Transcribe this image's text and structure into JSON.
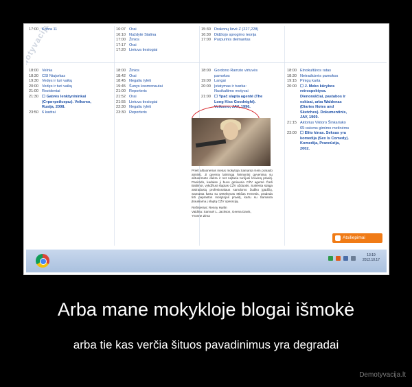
{
  "watermark": "Demotyvacija.lt",
  "schedule": {
    "col1_top": [
      {
        "time": "17:00",
        "name": "Kobra 11"
      }
    ],
    "col2_top": [
      {
        "time": "16:07",
        "name": "Orai"
      },
      {
        "time": "16:10",
        "name": "Nuždytė Stalina"
      },
      {
        "time": "17:00",
        "name": "Žinios"
      },
      {
        "time": "17:17",
        "name": "Orai"
      },
      {
        "time": "17:20",
        "name": "Lietuva tiesiogiai"
      }
    ],
    "col3_top": [
      {
        "time": "15:30",
        "name": "Drakonų lizvė Z (227,228)"
      },
      {
        "time": "16:30",
        "name": "Didžiojo sprogimo teorija"
      },
      {
        "time": "17:00",
        "name": "Purpurinis deimantas"
      }
    ],
    "col1": [
      {
        "time": "18:00",
        "name": "Velnia"
      },
      {
        "time": "18:30",
        "name": "CSI Niujorkas"
      },
      {
        "time": "19:30",
        "name": "Vedęs ir turi vaikų"
      },
      {
        "time": "20:00",
        "name": "Vedęs ir turi vaikų"
      },
      {
        "time": "21:00",
        "name": "Rezidentai"
      },
      {
        "time": "21:30",
        "name": "☐ Gatvės lenktynininkai"
      },
      {
        "time": "",
        "name": "(Стритрейсеры). Veiksmo,"
      },
      {
        "time": "",
        "name": "Rusija, 2008."
      },
      {
        "time": "23:50",
        "name": "6 kadrai"
      }
    ],
    "col2": [
      {
        "time": "18:00",
        "name": "Žinios"
      },
      {
        "time": "18:42",
        "name": "Orai"
      },
      {
        "time": "18:45",
        "name": "Negaliu tylėti"
      },
      {
        "time": "19:45",
        "name": "Šunys kosmonautai"
      },
      {
        "time": "21:00",
        "name": "Reporteris"
      },
      {
        "time": "21:52",
        "name": "Orai"
      },
      {
        "time": "21:55",
        "name": "Lietuva tiesiogiai"
      },
      {
        "time": "22:30",
        "name": "Negaliu tylėti"
      },
      {
        "time": "23:30",
        "name": "Reporteris"
      }
    ],
    "col3": [
      {
        "time": "18:00",
        "name": "Gordono Ramzio virtuvės"
      },
      {
        "time": "",
        "name": "pamokos"
      },
      {
        "time": "19:00",
        "name": "Langai"
      },
      {
        "time": "20:00",
        "name": "Įstatymas ir tvarka:"
      },
      {
        "time": "",
        "name": "Nusikaltimo motyvai"
      },
      {
        "time": "21:00",
        "name": "☐ Ypač slapta agentė (The"
      },
      {
        "time": "",
        "name": "Long Kiss Goodnight)."
      },
      {
        "time": "",
        "name": "Veiksmo, JAV, 1996."
      }
    ],
    "col4": [
      {
        "time": "18:00",
        "name": "Etnokultūros ratas"
      },
      {
        "time": "18:30",
        "name": "Netradicinės pamokos"
      },
      {
        "time": "19:15",
        "name": "Pinigų karta"
      },
      {
        "time": "20:00",
        "name": "☐ J. Meko kūrybos"
      },
      {
        "time": "",
        "name": "retrospektyva."
      },
      {
        "time": "",
        "name": "Dienoraščiai, pastabos ir"
      },
      {
        "time": "",
        "name": "eskizai, arba Waldenas"
      },
      {
        "time": "",
        "name": "(Diaries Notes and"
      },
      {
        "time": "",
        "name": "Sketches). Dokumentinis,"
      },
      {
        "time": "",
        "name": "JAV, 1969."
      },
      {
        "time": "21:15",
        "name": "Aktorius Viktoro Šinkariuko"
      },
      {
        "time": "",
        "name": "65-osioms gimimo metinėms"
      },
      {
        "time": "23:00",
        "name": "☐ Elito kinas. Seksas yra"
      },
      {
        "time": "",
        "name": "komedija (Sex Is Comedy)."
      },
      {
        "time": "",
        "name": "Komedija, Prancūzija,"
      },
      {
        "time": "",
        "name": "2002."
      }
    ]
  },
  "detail": {
    "description": "Prieš aštuonerius metus mokytoja Samanta Kein prarado atmintį. Ji gyvena laimingą šeimyninį gyvenimą su aštuonmete dukra ir net neįtaria turėjusi kruviną praeitį. Pasirodo, kadaise ji buvo geriausia CŽV agentė Čarli Baltimor, vykdžiusi slaptas CŽV užduotis. Sukrėsta staiga atsiradusių profesionalaus samdomo žudiko įgūdžių, Samanta kartu su Detektyvas Mitčas Henesis, pradeda tirti paprastos mokytojos praeitį, kartu su Samanta įtraukiama į slaptą CŽV operaciją.",
    "director": "Režisierius: Renny Harlin",
    "cast": "Vaidina: Samuel L. Jackson, Geena Davis,",
    "cast2": "Yvonne Zima"
  },
  "feedback_label": "Atsiliepimai",
  "clock": {
    "time": "13:19",
    "date": "2012.10.17"
  },
  "headline": "Arba mane mokykloje blogai išmokė",
  "subline": "arba tie kas verčia šituos pavadinimus yra degradai",
  "brand": "Demotyvacija.lt"
}
